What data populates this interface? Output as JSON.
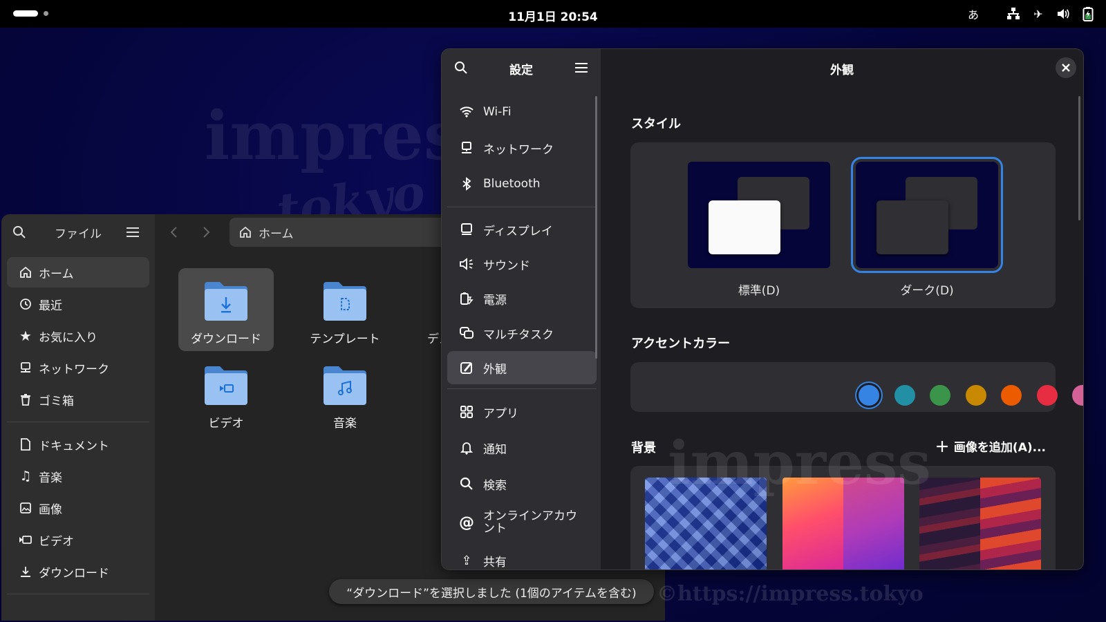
{
  "topbar": {
    "clock": "11月1日  20:54",
    "input_method": "あ"
  },
  "watermark": {
    "line1": "impress",
    "line2": "tokyo",
    "url": "©https://impress.tokyo"
  },
  "files": {
    "title": "ファイル",
    "path": "ホーム",
    "sidebar": [
      {
        "label": "ホーム",
        "icon": "home-icon",
        "active": true
      },
      {
        "label": "最近",
        "icon": "clock-icon"
      },
      {
        "label": "お気に入り",
        "icon": "star-icon"
      },
      {
        "label": "ネットワーク",
        "icon": "network-icon"
      },
      {
        "label": "ゴミ箱",
        "icon": "trash-icon"
      },
      {
        "label": "ドキュメント",
        "icon": "document-icon"
      },
      {
        "label": "音楽",
        "icon": "music-icon"
      },
      {
        "label": "画像",
        "icon": "image-icon"
      },
      {
        "label": "ビデオ",
        "icon": "video-icon"
      },
      {
        "label": "ダウンロード",
        "icon": "download-icon"
      }
    ],
    "folders": [
      {
        "label": "ダウンロード",
        "icon": "download-folder-icon",
        "selected": true
      },
      {
        "label": "テンプレート",
        "icon": "template-folder-icon"
      },
      {
        "label": "デス",
        "icon": "desktop-folder-icon"
      },
      {
        "label": "ビデオ",
        "icon": "video-folder-icon"
      },
      {
        "label": "音楽",
        "icon": "music-folder-icon"
      }
    ],
    "status": "“ダウンロード”を選択しました (1個のアイテムを含む)"
  },
  "settings": {
    "title": "設定",
    "nav": [
      {
        "label": "Wi-Fi",
        "icon": "wifi-icon"
      },
      {
        "label": "ネットワーク",
        "icon": "network-icon"
      },
      {
        "label": "Bluetooth",
        "icon": "bluetooth-icon"
      },
      {
        "label": "ディスプレイ",
        "icon": "display-icon"
      },
      {
        "label": "サウンド",
        "icon": "sound-icon"
      },
      {
        "label": "電源",
        "icon": "power-icon"
      },
      {
        "label": "マルチタスク",
        "icon": "multitask-icon"
      },
      {
        "label": "外観",
        "icon": "appearance-icon",
        "active": true
      },
      {
        "label": "アプリ",
        "icon": "apps-icon"
      },
      {
        "label": "通知",
        "icon": "bell-icon"
      },
      {
        "label": "検索",
        "icon": "search-icon"
      },
      {
        "label": "オンラインアカウント",
        "icon": "at-icon"
      },
      {
        "label": "共有",
        "icon": "share-icon"
      }
    ],
    "page_title": "外観",
    "style_heading": "スタイル",
    "style_options": [
      {
        "label": "標準(D)",
        "selected": false
      },
      {
        "label": "ダーク(D)",
        "selected": true
      }
    ],
    "accent_heading": "アクセントカラー",
    "accent_colors": [
      "#3584e4",
      "#2190a4",
      "#3a944a",
      "#c88800",
      "#ed5b00",
      "#e62d42",
      "#d56199",
      "#9141ac",
      "#6f8396"
    ],
    "accent_selected": 0,
    "background_heading": "背景",
    "add_image": "画像を追加(A)..."
  }
}
